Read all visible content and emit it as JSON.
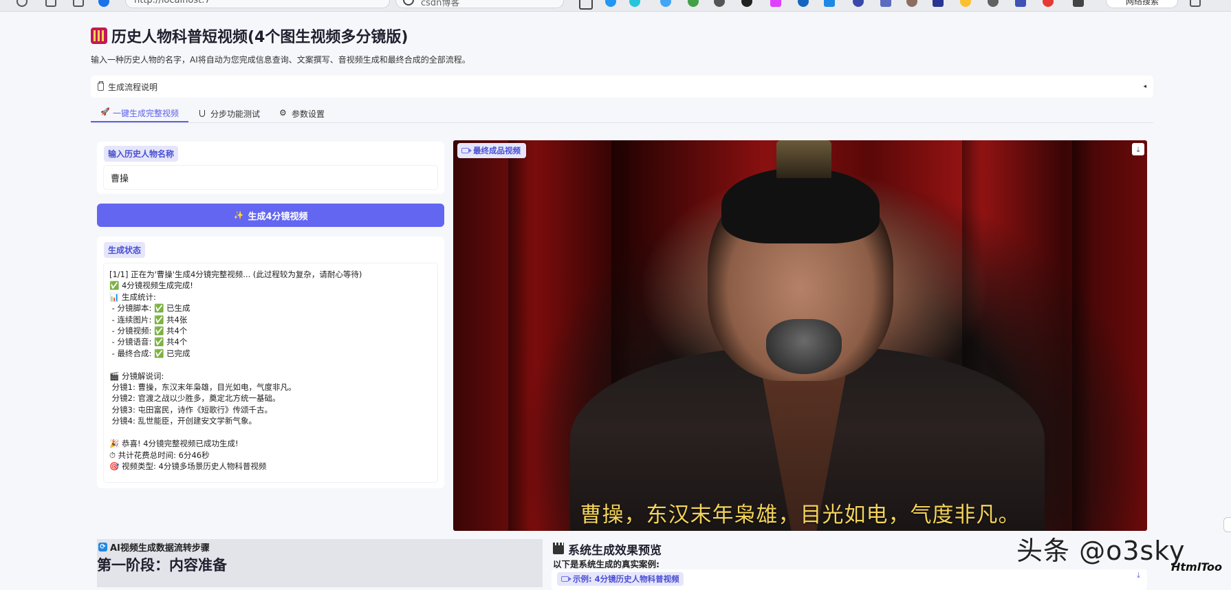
{
  "browser": {
    "address_text": "http://localhost:7",
    "search_text": "csdn博客",
    "profile_text": "网络搜索"
  },
  "page": {
    "title": "历史人物科普短视频(4个图生视频多分镜版)",
    "subtitle": "输入一种历史人物的名字，AI将自动为您完成信息查询、文案撰写、音视频生成和最终合成的全部流程。"
  },
  "accordion": {
    "label": "生成流程说明",
    "caret": "◂"
  },
  "tabs": [
    {
      "label": "一键生成完整视频",
      "icon": "rocket-icon",
      "active": true
    },
    {
      "label": "分步功能测试",
      "icon": "flask-icon",
      "active": false
    },
    {
      "label": "参数设置",
      "icon": "gear-icon",
      "active": false
    }
  ],
  "input_section": {
    "label": "输入历史人物名称",
    "value": "曹操"
  },
  "generate_button": {
    "label": "生成4分镜视频",
    "icon": "sparkle-icon"
  },
  "status_section": {
    "label": "生成状态",
    "text": "[1/1] 正在为'曹操'生成4分镜完整视频... (此过程较为复杂，请耐心等待)\n✅ 4分镜视频生成完成!\n📊 生成统计:\n - 分镜脚本: ✅ 已生成\n - 连续图片: ✅ 共4张\n - 分镜视频: ✅ 共4个\n - 分镜语音: ✅ 共4个\n - 最终合成: ✅ 已完成\n\n🎬 分镜解说词:\n 分镜1: 曹操，东汉末年枭雄，目光如电，气度非凡。\n 分镜2: 官渡之战以少胜多，奠定北方统一基础。\n 分镜3: 屯田富民，诗作《短歌行》传颂千古。\n 分镜4: 乱世能臣，开创建安文学新气象。\n\n🎉 恭喜! 4分镜完整视频已成功生成!\n⏱ 共计花费总时间: 6分46秒\n🎯 视频类型: 4分镜多场景历史人物科普视频"
  },
  "video_section": {
    "label": "最终成品视频",
    "caption": "曹操，东汉末年枭雄，目光如电，气度非凡。"
  },
  "flow_section": {
    "header": "AI视频生成数据流转步骤",
    "phase_title": "第一阶段：内容准备"
  },
  "preview_section": {
    "title": "系统生成效果预览",
    "description": "以下是系统生成的真实案例:",
    "example_label": "示例: 4分镜历史人物科普视频"
  },
  "watermark": {
    "main": "头条 @o3sky",
    "sub": "HtmlToo"
  },
  "colors": {
    "accent": "#6366f1",
    "chip_bg": "#e5e6fb",
    "caption": "#f3d35b"
  }
}
